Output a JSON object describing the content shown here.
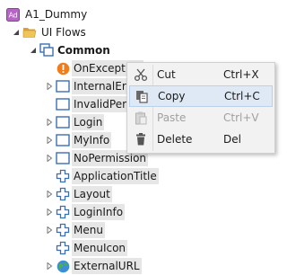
{
  "tree": {
    "root": {
      "badge": "Ad",
      "label": "A1_Dummy"
    },
    "ui_flows": {
      "label": "UI Flows"
    },
    "common": {
      "label": "Common"
    },
    "items": [
      {
        "label": "OnException",
        "icon": "exception-icon"
      },
      {
        "label": "InternalError",
        "icon": "web-screen-icon"
      },
      {
        "label": "InvalidPermissions",
        "icon": "web-screen-icon"
      },
      {
        "label": "Login",
        "icon": "web-screen-icon"
      },
      {
        "label": "MyInfo",
        "icon": "web-screen-icon"
      },
      {
        "label": "NoPermission",
        "icon": "web-screen-icon"
      },
      {
        "label": "ApplicationTitle",
        "icon": "web-block-icon"
      },
      {
        "label": "Layout",
        "icon": "web-block-icon"
      },
      {
        "label": "LoginInfo",
        "icon": "web-block-icon"
      },
      {
        "label": "Menu",
        "icon": "web-block-icon"
      },
      {
        "label": "MenuIcon",
        "icon": "web-block-icon"
      },
      {
        "label": "ExternalURL",
        "icon": "globe-icon"
      }
    ]
  },
  "context_menu": {
    "items": [
      {
        "label": "Cut",
        "shortcut": "Ctrl+X",
        "icon": "scissors-icon"
      },
      {
        "label": "Copy",
        "shortcut": "Ctrl+C",
        "icon": "copy-icon"
      },
      {
        "label": "Paste",
        "shortcut": "Ctrl+V",
        "icon": "paste-icon"
      },
      {
        "label": "Delete",
        "shortcut": "Del",
        "icon": "trash-icon"
      }
    ]
  },
  "colors": {
    "folder": "#e8b64c",
    "screen_icon": "#3a6fb5",
    "exception": "#f07c1b",
    "highlight": "#e6e6e6",
    "menu_selected": "#dfe9f5"
  }
}
